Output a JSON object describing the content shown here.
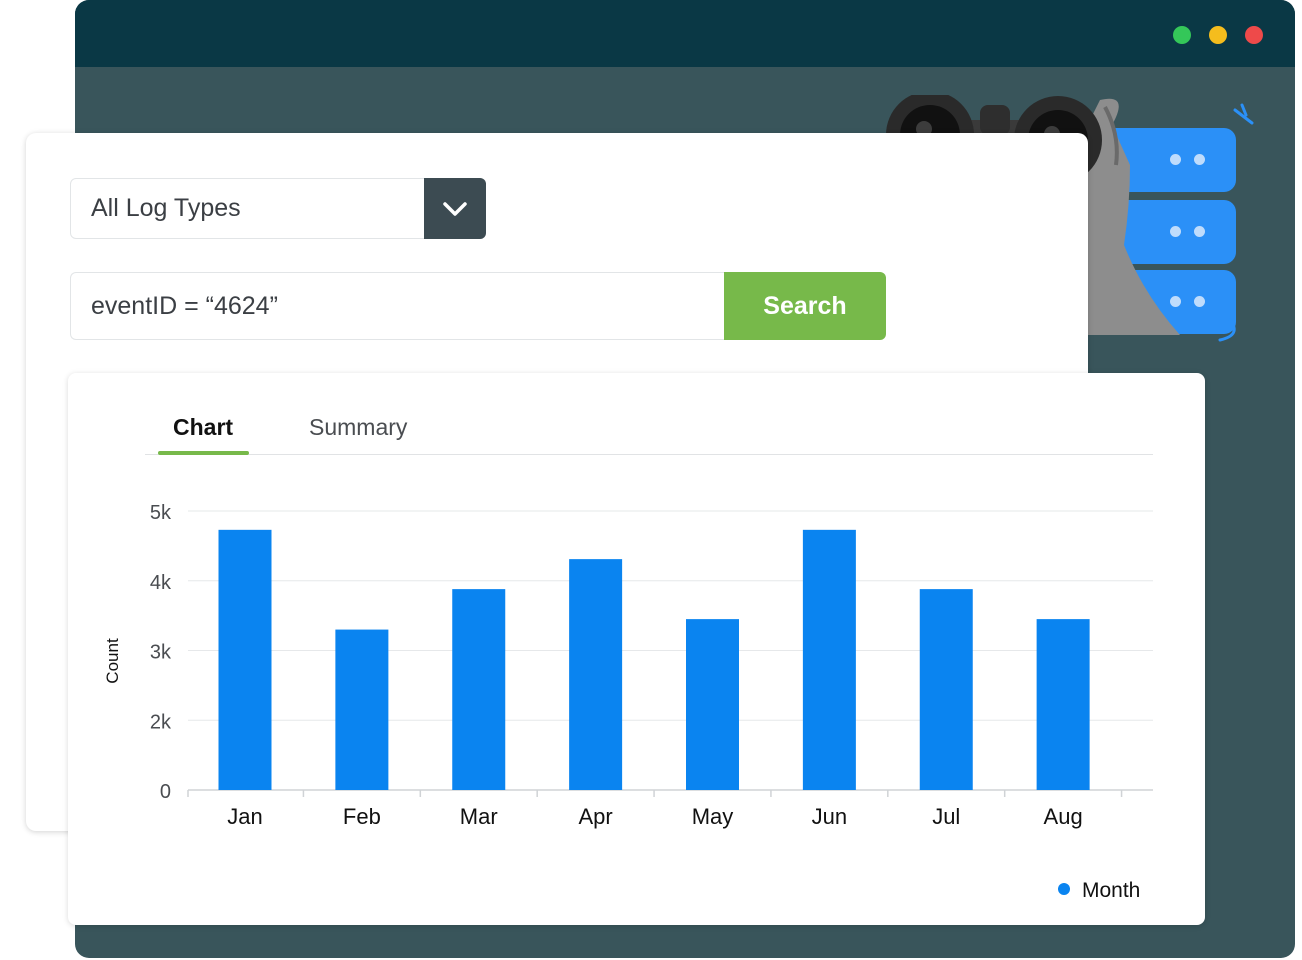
{
  "window": {
    "controls": [
      {
        "name": "minimize",
        "color": "#34c759"
      },
      {
        "name": "maximize",
        "color": "#f5bd1d"
      },
      {
        "name": "close",
        "color": "#ee4a4a"
      }
    ]
  },
  "filter": {
    "log_type_value": "All Log Types",
    "dropdown_icon": "chevron-down-icon"
  },
  "search": {
    "query_value": "eventID = “4624”",
    "button_label": "Search"
  },
  "tabs": [
    {
      "label": "Chart",
      "active": true
    },
    {
      "label": "Summary",
      "active": false
    }
  ],
  "colors": {
    "accent_green": "#77b94a",
    "bar_blue": "#0a84f0",
    "titlebar": "#0a3845",
    "window_body": "#39555b"
  },
  "chart_data": {
    "type": "bar",
    "categories": [
      "Jan",
      "Feb",
      "Mar",
      "Apr",
      "May",
      "Jun",
      "Jul",
      "Aug"
    ],
    "series": [
      {
        "name": "Month",
        "values": [
          4730,
          3300,
          3880,
          4310,
          3450,
          4730,
          3880,
          3450
        ]
      }
    ],
    "ylabel": "Count",
    "xlabel": "",
    "ylim": [
      1000,
      5000
    ],
    "yticks": [
      {
        "value": 1000,
        "label": "0"
      },
      {
        "value": 2000,
        "label": "2k"
      },
      {
        "value": 3000,
        "label": "3k"
      },
      {
        "value": 4000,
        "label": "4k"
      },
      {
        "value": 5000,
        "label": "5k"
      }
    ],
    "grid": true,
    "legend": "bottom-right"
  }
}
